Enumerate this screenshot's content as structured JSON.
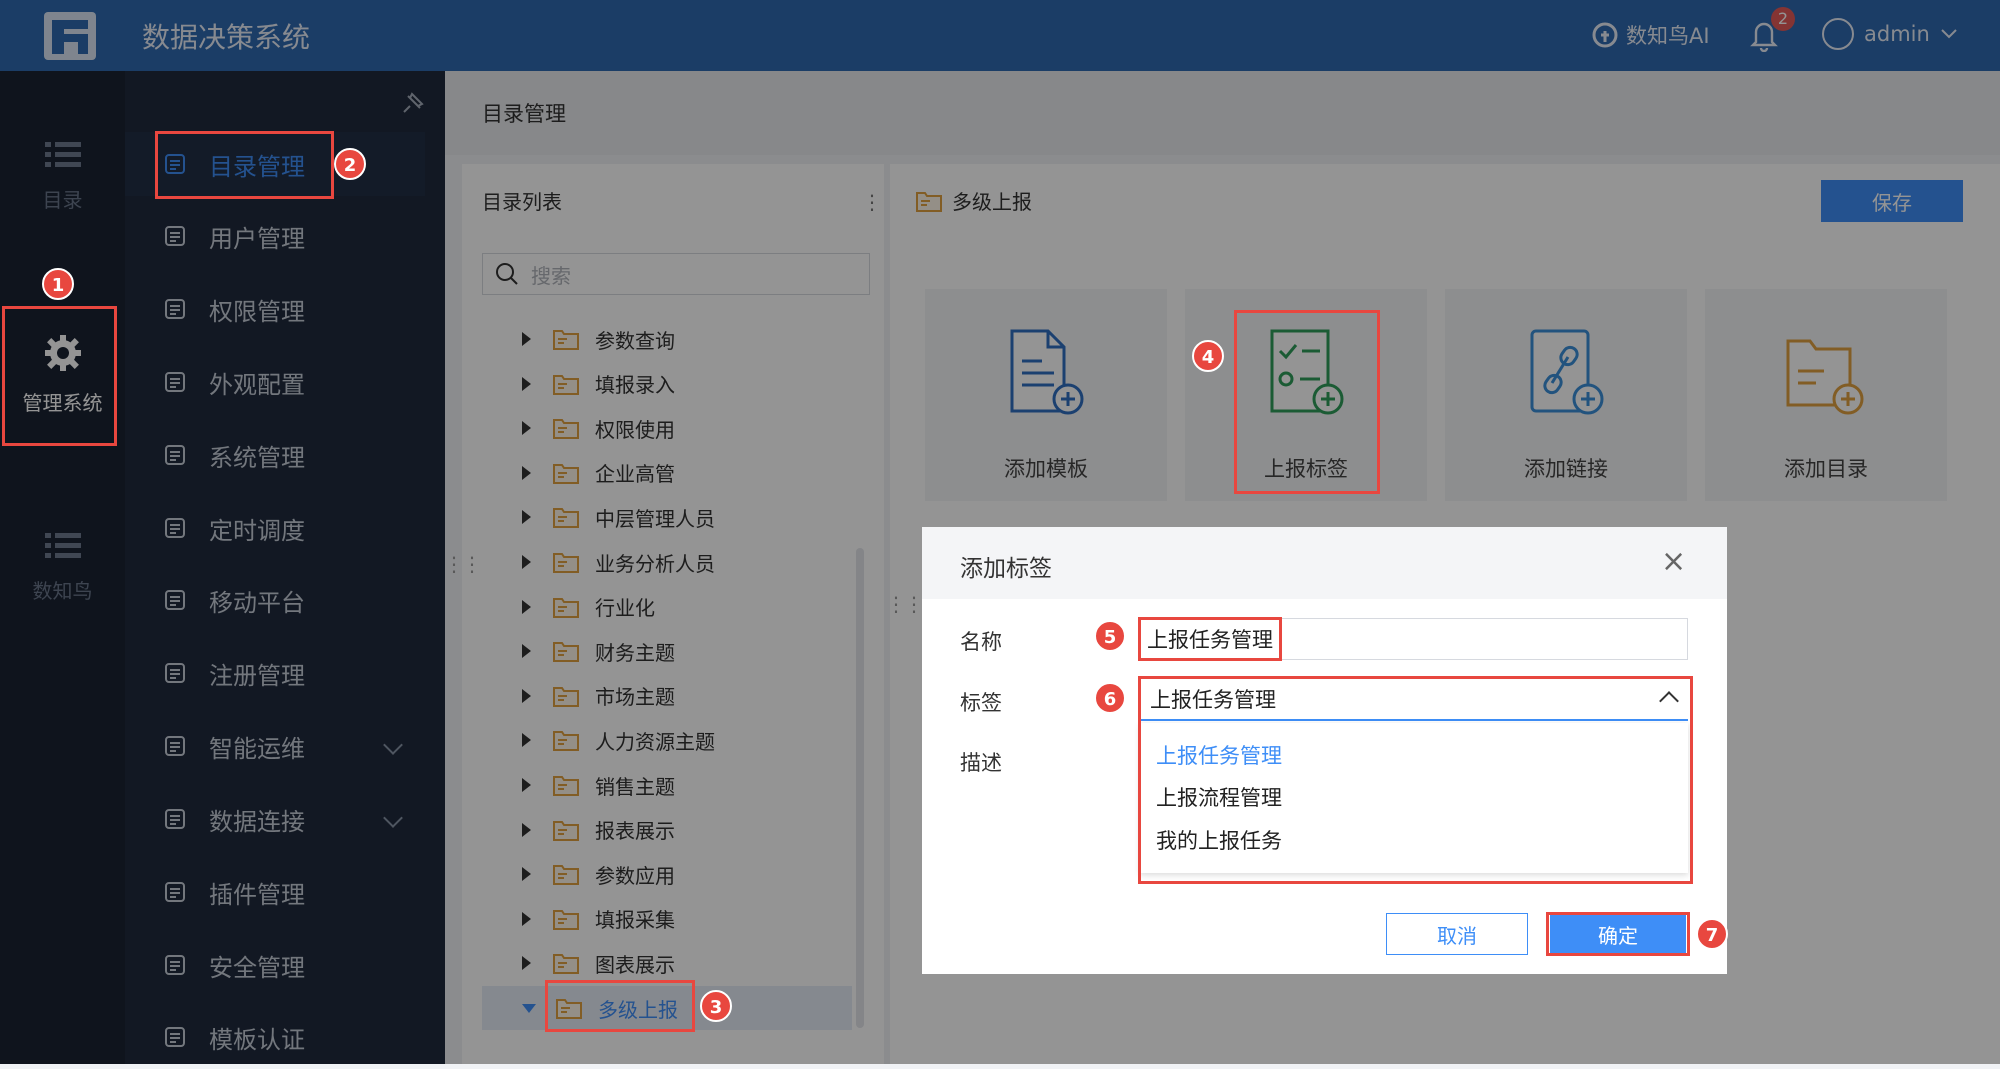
{
  "topbar": {
    "app_title": "数据决策系统",
    "ai_label": "数知鸟AI",
    "notification_count": "2",
    "username": "admin"
  },
  "rail": {
    "items": [
      {
        "label": "目录",
        "icon": "list-icon"
      },
      {
        "label": "管理系统",
        "icon": "gear-icon"
      },
      {
        "label": "数知鸟",
        "icon": "list-icon"
      }
    ]
  },
  "menu": {
    "items": [
      {
        "label": "目录管理",
        "icon": "directory-icon"
      },
      {
        "label": "用户管理",
        "icon": "user-icon"
      },
      {
        "label": "权限管理",
        "icon": "shield-icon"
      },
      {
        "label": "外观配置",
        "icon": "brush-icon"
      },
      {
        "label": "系统管理",
        "icon": "gear-icon"
      },
      {
        "label": "定时调度",
        "icon": "timer-icon"
      },
      {
        "label": "移动平台",
        "icon": "mobile-icon"
      },
      {
        "label": "注册管理",
        "icon": "register-icon"
      },
      {
        "label": "智能运维",
        "icon": "ops-icon"
      },
      {
        "label": "数据连接",
        "icon": "link-icon"
      },
      {
        "label": "插件管理",
        "icon": "plugin-icon"
      },
      {
        "label": "安全管理",
        "icon": "security-icon"
      },
      {
        "label": "模板认证",
        "icon": "certificate-icon"
      }
    ]
  },
  "content": {
    "title": "目录管理"
  },
  "directory": {
    "title": "目录列表",
    "more": "⋮",
    "search_placeholder": "搜索",
    "items": [
      "参数查询",
      "填报录入",
      "权限使用",
      "企业高管",
      "中层管理人员",
      "业务分析人员",
      "行业化",
      "财务主题",
      "市场主题",
      "人力资源主题",
      "销售主题",
      "报表展示",
      "参数应用",
      "填报采集",
      "图表展示",
      "多级上报"
    ],
    "selected": "多级上报"
  },
  "right_panel": {
    "title": "多级上报",
    "save_label": "保存",
    "cards": [
      {
        "label": "添加模板",
        "icon": "add-template-icon",
        "color": "#2f6fc2"
      },
      {
        "label": "上报标签",
        "icon": "report-tag-icon",
        "color": "#2f9e5a"
      },
      {
        "label": "添加链接",
        "icon": "add-link-icon",
        "color": "#3b8fd9"
      },
      {
        "label": "添加目录",
        "icon": "add-folder-icon",
        "color": "#e0a040"
      }
    ]
  },
  "modal": {
    "title": "添加标签",
    "close": "×",
    "name_label": "名称",
    "name_value": "上报任务管理",
    "tag_label": "标签",
    "tag_value": "上报任务管理",
    "desc_label": "描述",
    "options": [
      "上报任务管理",
      "上报流程管理",
      "我的上报任务"
    ],
    "cancel_label": "取消",
    "ok_label": "确定"
  },
  "steps": [
    "1",
    "2",
    "3",
    "4",
    "5",
    "6",
    "7"
  ],
  "colors": {
    "topbar": "#2f69b0",
    "accent": "#3e8ef7",
    "highlight": "#e8473f",
    "rail_bg": "#1b2433",
    "menu_bg": "#1f2a3d"
  }
}
